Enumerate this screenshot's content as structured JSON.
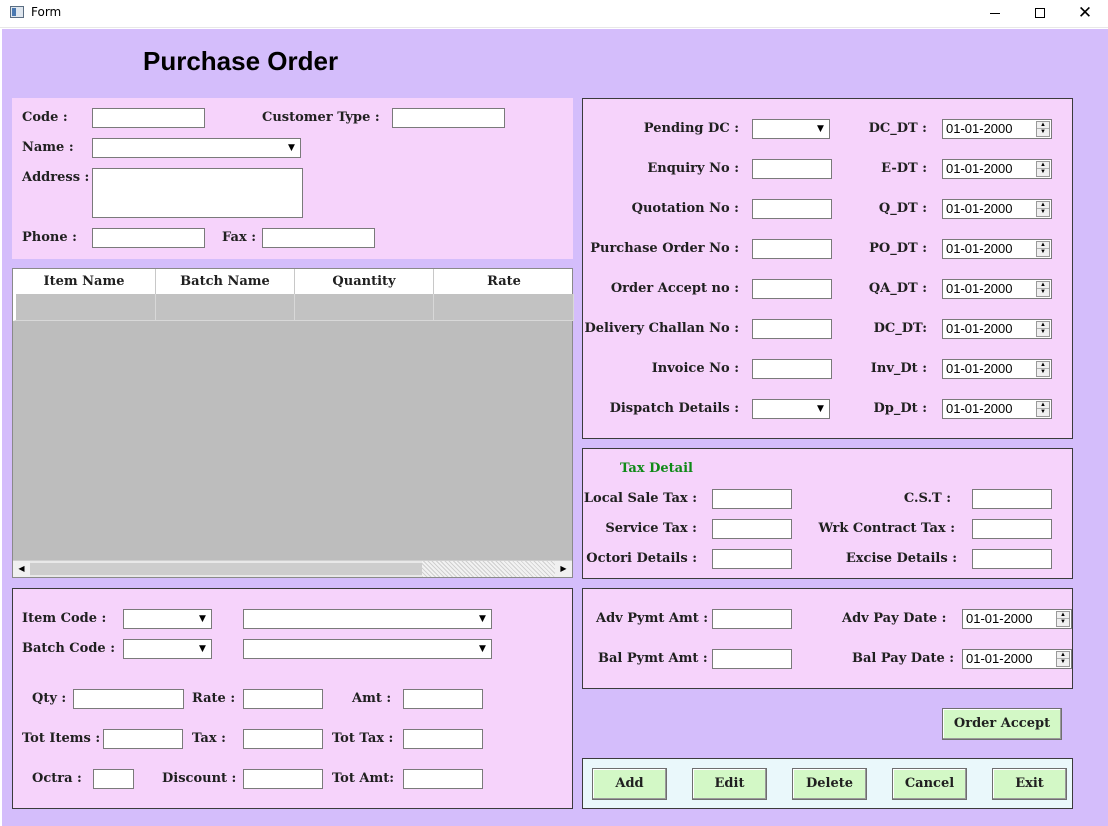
{
  "window": {
    "title": "Form",
    "minimize": "—",
    "maximize": "",
    "close": "✕"
  },
  "heading": "Purchase Order",
  "customer": {
    "code_label": "Code :",
    "code_value": "",
    "customer_type_label": "Customer Type :",
    "customer_type_value": "",
    "name_label": "Name :",
    "name_value": "",
    "address_label": "Address :",
    "address_value": "",
    "phone_label": "Phone :",
    "phone_value": "",
    "fax_label": "Fax :",
    "fax_value": ""
  },
  "grid": {
    "columns": [
      "Item Name",
      "Batch Name",
      "Quantity",
      "Rate"
    ],
    "rows": [
      [
        "",
        "",
        "",
        ""
      ]
    ],
    "scroll_left": "◀",
    "scroll_right": "▶"
  },
  "docs": {
    "pending_dc_label": "Pending DC :",
    "dc_dt_label": "DC_DT  :",
    "enquiry_no_label": "Enquiry No  :",
    "e_dt_label": "E-DT  :",
    "quotation_no_label": "Quotation No :",
    "q_dt_label": "Q_DT  :",
    "purchase_order_no_label": "Purchase Order  No :",
    "po_dt_label": "PO_DT  :",
    "order_accept_no_label": "Order Accept no   :",
    "qa_dt_label": "QA_DT  :",
    "delivery_challan_no_label": "Delivery Challan No  :",
    "dc_dt2_label": "DC_DT:",
    "invoice_no_label": "Invoice No :",
    "inv_dt_label": "Inv_Dt  :",
    "dispatch_details_label": "Dispatch Details :",
    "dp_dt_label": "Dp_Dt  :",
    "date_value": "01-01-2000"
  },
  "tax": {
    "heading": "Tax Detail",
    "local_sale_tax_label": "Local Sale Tax :",
    "cst_label": "C.S.T :",
    "service_tax_label": "Service Tax  :",
    "wrk_contract_tax_label": "Wrk Contract Tax :",
    "octori_details_label": "Octori Details :",
    "excise_details_label": "Excise Details   :"
  },
  "payment": {
    "adv_pymt_amt_label": "Adv Pymt Amt :",
    "adv_pay_date_label": "Adv Pay Date  :",
    "adv_pay_date_value": "01-01-2000",
    "bal_pymt_amt_label": "Bal Pymt Amt :",
    "bal_pay_date_label": "Bal Pay Date :",
    "bal_pay_date_value": "01-01-2000"
  },
  "item_entry": {
    "item_code_label": "Item Code   :",
    "batch_code_label": "Batch Code :",
    "qty_label": "Qty :",
    "rate_label": "Rate :",
    "amt_label": "Amt :",
    "tot_items_label": "Tot Items :",
    "tax_label": "Tax   :",
    "tot_tax_label": "Tot Tax :",
    "octra_label": "Octra :",
    "discount_label": "Discount  :",
    "tot_amt_label": "Tot Amt:"
  },
  "buttons": {
    "order_accept": "Order Accept",
    "add": "Add",
    "edit": "Edit",
    "delete": "Delete",
    "cancel": "Cancel",
    "exit": "Exit"
  },
  "icons": {
    "dropdown": "▼",
    "spin_up": "▲",
    "spin_down": "▼"
  },
  "colors": {
    "form_background": "#d4bdfb",
    "panel_background": "#f6d3fb",
    "button_background": "#d3f8c6",
    "tax_heading": "#0f8a17"
  }
}
